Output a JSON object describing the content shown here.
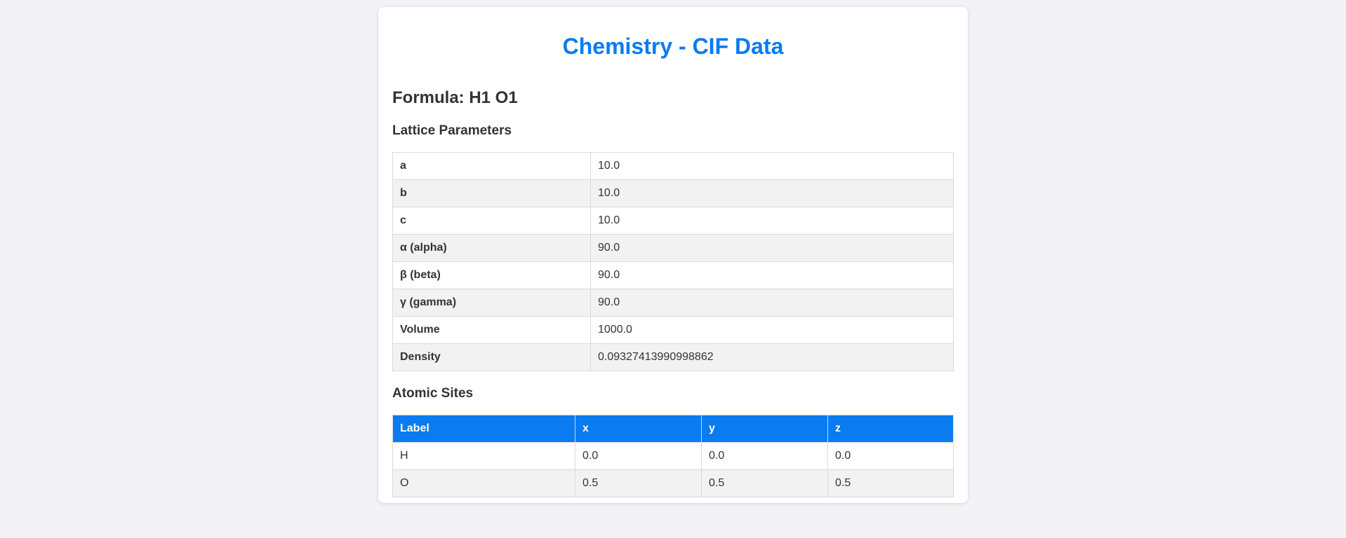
{
  "page": {
    "title": "Chemistry - CIF Data",
    "formula": "Formula: H1 O1"
  },
  "lattice": {
    "heading": "Lattice Parameters",
    "rows": [
      {
        "key": "a",
        "value": "10.0"
      },
      {
        "key": "b",
        "value": "10.0"
      },
      {
        "key": "c",
        "value": "10.0"
      },
      {
        "key": "α (alpha)",
        "value": "90.0"
      },
      {
        "key": "β (beta)",
        "value": "90.0"
      },
      {
        "key": "γ (gamma)",
        "value": "90.0"
      },
      {
        "key": "Volume",
        "value": "1000.0"
      },
      {
        "key": "Density",
        "value": "0.09327413990998862"
      }
    ]
  },
  "sites": {
    "heading": "Atomic Sites",
    "columns": [
      "Label",
      "x",
      "y",
      "z"
    ],
    "rows": [
      [
        "H",
        "0.0",
        "0.0",
        "0.0"
      ],
      [
        "O",
        "0.5",
        "0.5",
        "0.5"
      ]
    ]
  },
  "colors": {
    "accent": "#0a7bf0",
    "background": "#f3f3f7",
    "row_alt": "#f2f2f2"
  }
}
